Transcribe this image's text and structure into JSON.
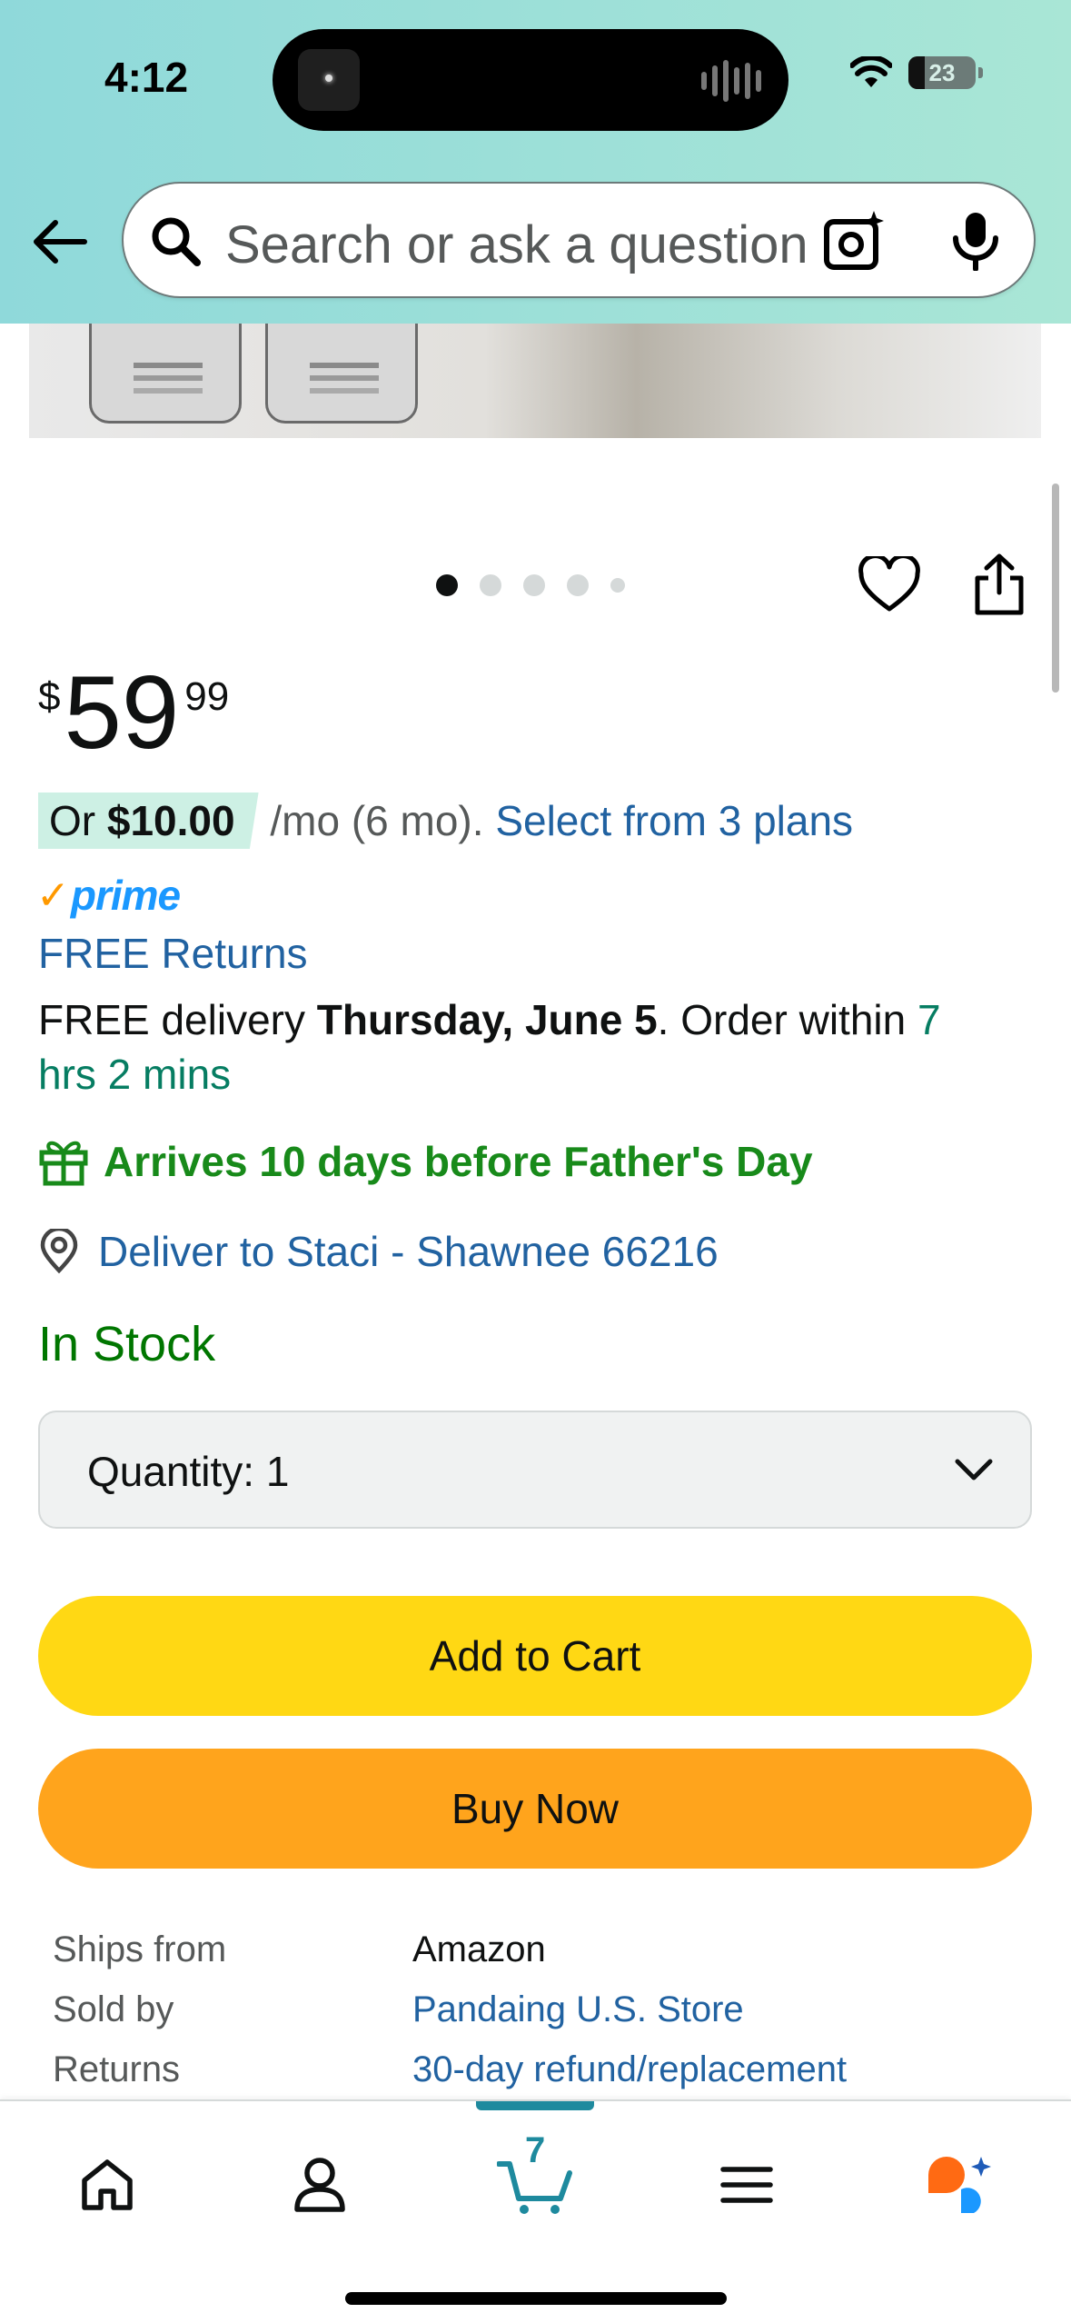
{
  "status_bar": {
    "time": "4:12",
    "battery": "23"
  },
  "search": {
    "placeholder": "Search or ask a question"
  },
  "gallery": {
    "dots": 5,
    "active_index": 0
  },
  "price": {
    "symbol": "$",
    "whole": "59",
    "fraction": "99"
  },
  "installments": {
    "prefix": "Or ",
    "amount": "$10.00",
    "terms": " /mo (6 mo). ",
    "link": "Select from 3 plans"
  },
  "prime": {
    "check": "✓",
    "label": "prime"
  },
  "returns": "FREE Returns",
  "delivery": {
    "prefix": "FREE delivery ",
    "date": "Thursday, June 5",
    "middle": ". Order within ",
    "countdown": "7 hrs 2 mins"
  },
  "gift_message": "Arrives 10 days before Father's Day",
  "deliver_to": "Deliver to Staci - Shawnee 66216",
  "stock": "In Stock",
  "quantity": {
    "label": "Quantity:",
    "value": "1"
  },
  "buttons": {
    "add_to_cart": "Add to Cart",
    "buy_now": "Buy Now"
  },
  "details": [
    {
      "key": "Ships from",
      "value": "Amazon",
      "is_link": false
    },
    {
      "key": "Sold by",
      "value": "Pandaing U.S. Store",
      "is_link": true
    },
    {
      "key": "Returns",
      "value": "30-day refund/replacement",
      "is_link": true
    }
  ],
  "bottom_nav": {
    "items": [
      "home-icon",
      "account-icon",
      "cart-icon",
      "menu-icon",
      "rufus-ai-icon"
    ],
    "cart_count": "7",
    "active": "cart"
  },
  "colors": {
    "add_to_cart": "#ffd814",
    "buy_now": "#ffa41c",
    "link": "#2162a1",
    "in_stock": "#007600",
    "gift": "#188a1a",
    "prime": "#1a98ff",
    "cart_active": "#1e8a9e"
  }
}
